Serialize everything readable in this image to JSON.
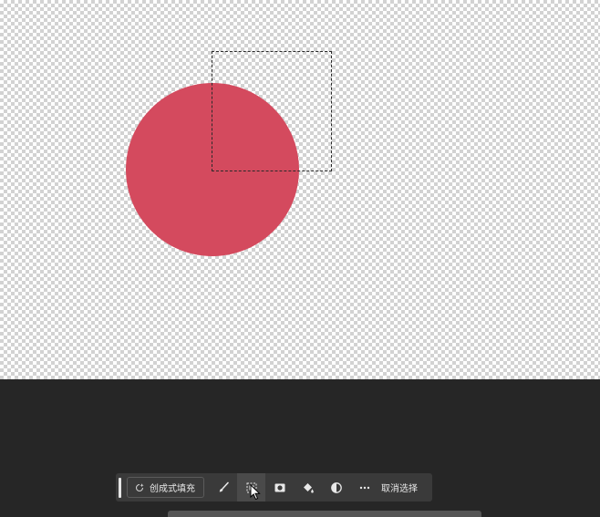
{
  "canvas": {
    "background": "transparent-checkerboard",
    "shape_color": "#d44a5e",
    "shape_icon": "circle"
  },
  "selection": {
    "style": "marquee-dashed"
  },
  "taskbar": {
    "generative_fill_label": "创成式填充",
    "generative_fill_icon": "sparkle-refresh-icon",
    "tools": [
      {
        "name": "brush",
        "icon": "brush-icon"
      },
      {
        "name": "selection-modify",
        "icon": "selection-modify-icon"
      },
      {
        "name": "mask",
        "icon": "mask-icon"
      },
      {
        "name": "fill",
        "icon": "paint-bucket-icon"
      },
      {
        "name": "adjustment",
        "icon": "adjustment-icon"
      },
      {
        "name": "more",
        "icon": "more-icon"
      }
    ],
    "deselect_label": "取消选择",
    "active_tool": "selection-modify"
  },
  "colors": {
    "taskbar_bg": "#3a3a3a",
    "workspace_bg": "#262626",
    "text": "#e8e8e8"
  }
}
